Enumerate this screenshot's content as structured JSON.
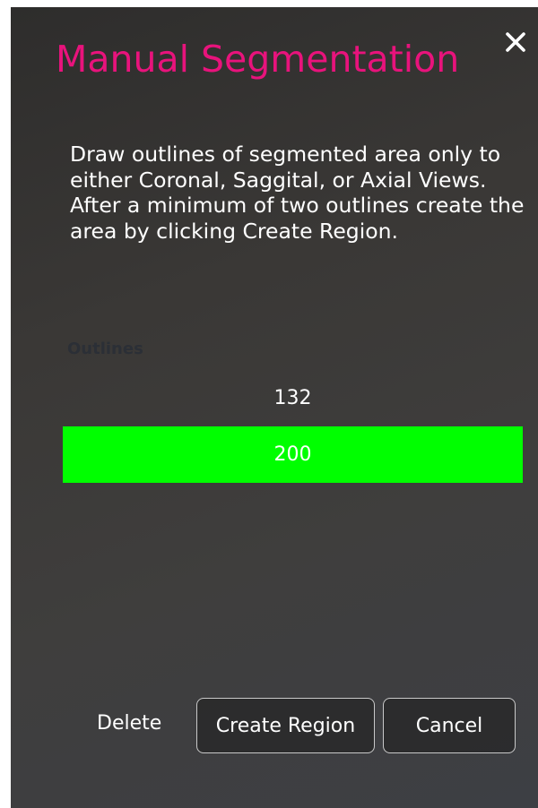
{
  "dialog": {
    "title": "Manual Segmentation",
    "close_icon": "close-icon",
    "instructions": [
      "Draw outlines of segmented area only to either Coronal, Saggital, or Axial Views.",
      "After a minimum of two outlines create the area by clicking Create Region."
    ],
    "outlines_label": "Outlines",
    "outlines": [
      {
        "value": "132",
        "selected": false
      },
      {
        "value": "200",
        "selected": true
      }
    ],
    "delete_label": "Delete",
    "create_region_label": "Create Region",
    "cancel_label": "Cancel"
  },
  "colors": {
    "title": "#e8137c",
    "selected_row": "#00ff00",
    "outlines_label": "#2b2f36"
  }
}
